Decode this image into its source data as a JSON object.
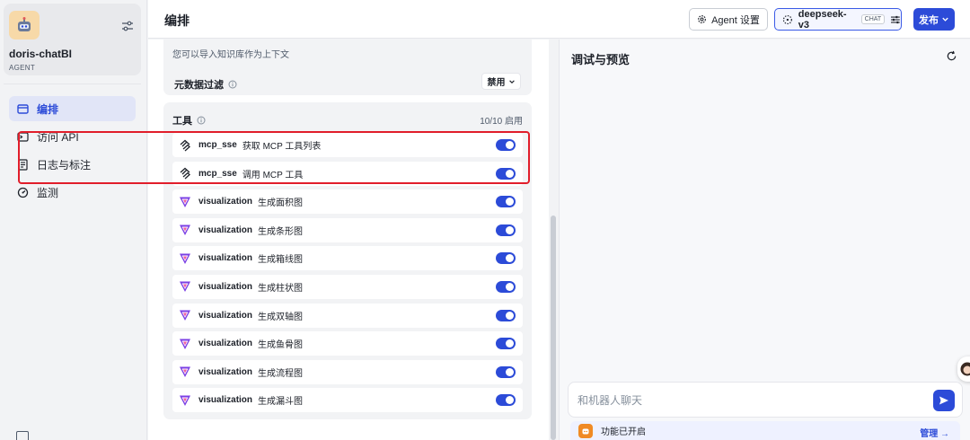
{
  "app": {
    "name": "doris-chatBI",
    "type": "AGENT"
  },
  "nav": {
    "items": [
      {
        "label": "编排",
        "icon": "layout-icon",
        "active": true
      },
      {
        "label": "访问 API",
        "icon": "terminal-icon",
        "active": false
      },
      {
        "label": "日志与标注",
        "icon": "document-icon",
        "active": false
      },
      {
        "label": "监测",
        "icon": "gauge-icon",
        "active": false
      }
    ]
  },
  "header": {
    "title": "编排",
    "agent_settings_label": "Agent 设置",
    "model_name": "deepseek-v3",
    "model_badge": "CHAT",
    "publish_label": "发布"
  },
  "knowledge": {
    "hint": "您可以导入知识库作为上下文",
    "metadata_filter_label": "元数据过滤",
    "metadata_filter_value": "禁用"
  },
  "tools": {
    "title": "工具",
    "count_label": "10/10 启用",
    "items": [
      {
        "name": "mcp_sse",
        "desc": "获取 MCP 工具列表",
        "icon": "mcp-icon",
        "enabled": true
      },
      {
        "name": "mcp_sse",
        "desc": "调用 MCP 工具",
        "icon": "mcp-icon",
        "enabled": true
      },
      {
        "name": "visualization",
        "desc": "生成面积图",
        "icon": "visualization-icon",
        "enabled": true
      },
      {
        "name": "visualization",
        "desc": "生成条形图",
        "icon": "visualization-icon",
        "enabled": true
      },
      {
        "name": "visualization",
        "desc": "生成箱线图",
        "icon": "visualization-icon",
        "enabled": true
      },
      {
        "name": "visualization",
        "desc": "生成柱状图",
        "icon": "visualization-icon",
        "enabled": true
      },
      {
        "name": "visualization",
        "desc": "生成双轴图",
        "icon": "visualization-icon",
        "enabled": true
      },
      {
        "name": "visualization",
        "desc": "生成鱼骨图",
        "icon": "visualization-icon",
        "enabled": true
      },
      {
        "name": "visualization",
        "desc": "生成流程图",
        "icon": "visualization-icon",
        "enabled": true
      },
      {
        "name": "visualization",
        "desc": "生成漏斗图",
        "icon": "visualization-icon",
        "enabled": true
      }
    ]
  },
  "preview": {
    "title": "调试与预览",
    "input_placeholder": "和机器人聊天",
    "feature_label": "功能已开启",
    "manage_label": "管理 →"
  },
  "colors": {
    "accent": "#2c4bd8",
    "highlight": "#e11d2a",
    "feature_icon": "#f08a24"
  }
}
